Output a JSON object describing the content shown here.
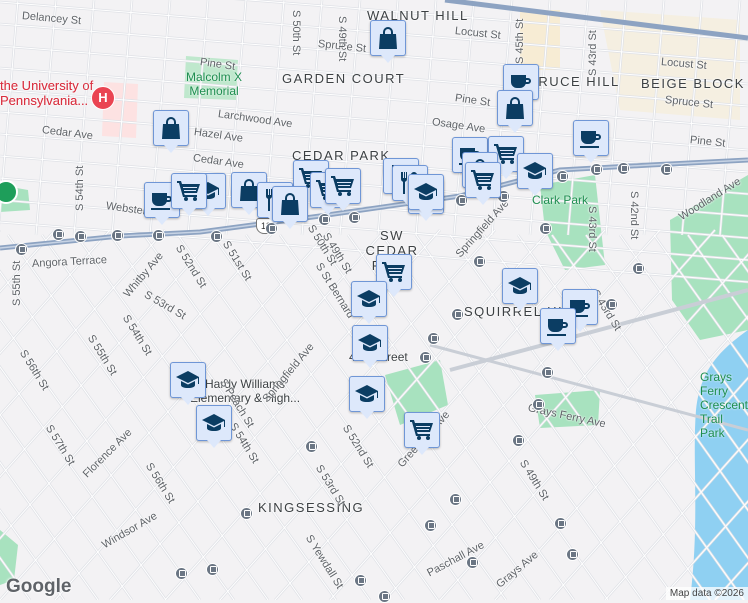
{
  "map": {
    "neighborhoods": [
      "WALNUT HILL",
      "GARDEN COURT",
      "SPRUCE HILL",
      "BEIGE BLOCK",
      "CEDAR PARK",
      "SW CEDAR PARK",
      "SQUIRREL HILL",
      "KINGSESSING"
    ],
    "parks": [
      "Malcolm X Memorial",
      "Clark Park",
      "Grays Ferry Crescent Trail Park"
    ],
    "poi": {
      "hospital": "the University of Pennsylvania...",
      "hospital_line1": "the University",
      "hospital_line2": "Pennsylvania...",
      "hospital_icon": "H",
      "school": "Hardy Williams Elementary & High...",
      "school_line1": "Hardy Williams",
      "school_line2": "Elementary & High...",
      "station": "49th Street"
    },
    "streets": [
      "Delancey St",
      "Spruce St",
      "Locust St",
      "S 45th St",
      "S 43rd St",
      "Locust St",
      "Pine St",
      "Spruce St",
      "Pine St",
      "Osage Ave",
      "Pine St",
      "Larchwood Ave",
      "Hazel Ave",
      "Cedar Ave",
      "Cedar Ave",
      "Webster",
      "S 54th St",
      "S 55th St",
      "Angora Terrace",
      "Whitby Ave",
      "S 52nd St",
      "S 51st St",
      "S 50th St",
      "S 49th St",
      "S St Bernard",
      "Springfield Ave",
      "S 43rd St",
      "S 42nd St",
      "Woodland Ave",
      "S 43rd St",
      "S 53rd St",
      "S 54th St",
      "S 55th St",
      "S 56th St",
      "S 57th St",
      "Springfield Ave",
      "S Peach St",
      "S 54th St",
      "Florence Ave",
      "S 56th St",
      "S 52nd St",
      "S 53rd St",
      "Greenway Ave",
      "Grays Ferry Ave",
      "S 49th St",
      "Windsor Ave",
      "S Yewdall St",
      "Paschall Ave",
      "Grays Ave",
      "S 50th St",
      "S 49th St",
      "13"
    ],
    "markers": [
      "shopping-bag",
      "coffee",
      "shopping-bag",
      "shopping-bag",
      "coffee",
      "coffee",
      "shopping-cart",
      "shopping-bag",
      "shopping-cart",
      "graduation-cap",
      "restaurant",
      "restaurant",
      "graduation-cap",
      "coffee",
      "shopping-cart",
      "graduation-cap",
      "shopping-bag",
      "restaurant",
      "shopping-bag",
      "shopping-cart",
      "shopping-cart",
      "shopping-cart",
      "graduation-cap",
      "shopping-cart",
      "graduation-cap",
      "coffee",
      "coffee",
      "graduation-cap",
      "graduation-cap",
      "graduation-cap",
      "graduation-cap",
      "graduation-cap",
      "shopping-cart"
    ]
  },
  "footer": {
    "logo": "Google",
    "attribution": "Map data ©2026"
  },
  "colors": {
    "marker_bg": "#dde8fb",
    "marker_icon": "#0b3d63",
    "park": "#a8e2bf",
    "water": "#8fd0f2",
    "major_road": "#8da3c2"
  }
}
